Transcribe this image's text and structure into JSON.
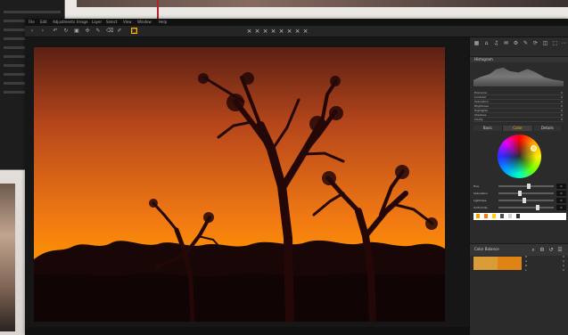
{
  "app": {
    "menu_items": [
      "File",
      "Edit",
      "Adjustments",
      "Image",
      "Layer",
      "Select",
      "View",
      "Window",
      "Help"
    ],
    "toolbar_icons": [
      "arrow-left-icon",
      "arrow-right-icon",
      "undo-icon",
      "rotate-icon",
      "crop-icon",
      "heal-icon",
      "brush-icon",
      "eraser-icon",
      "pen-icon",
      "box-icon"
    ],
    "toolbar_glyphs": [
      "‹",
      "›",
      "↶",
      "↻",
      "▣",
      "✣",
      "✎",
      "⌫",
      "✐",
      "▢"
    ],
    "viewer_control_glyphs": [
      "×",
      "×",
      "×",
      "×",
      "×",
      "×",
      "×",
      "×"
    ],
    "viewer_status_left": "",
    "viewer_status_center": "",
    "viewer_status_right": ""
  },
  "panel": {
    "top_glyphs": [
      "▦",
      "⌂",
      "♫",
      "✉",
      "⚙",
      "✎",
      "⟳",
      "◫",
      "⬚",
      "⋯"
    ],
    "histogram_title": "Histogram",
    "exposure_rows": [
      {
        "label": "Exposure",
        "value": "0"
      },
      {
        "label": "Contrast",
        "value": "0"
      },
      {
        "label": "Saturation",
        "value": "0"
      },
      {
        "label": "Brightness",
        "value": "0"
      },
      {
        "label": "Highlights",
        "value": "0"
      },
      {
        "label": "Shadows",
        "value": "0"
      },
      {
        "label": "Clarity",
        "value": "0"
      }
    ],
    "tabs": [
      "Basic",
      "Color",
      "Details"
    ],
    "sliders": [
      {
        "label": "Hue",
        "value": "0",
        "knob": 0.55
      },
      {
        "label": "Saturation",
        "value": "0",
        "knob": 0.38
      },
      {
        "label": "Lightness",
        "value": "0",
        "knob": 0.46
      },
      {
        "label": "Uniformity",
        "value": "0",
        "knob": 0.72
      }
    ],
    "color_title": "Color Balance",
    "mini_rows": [
      {
        "label": "R",
        "value": "0"
      },
      {
        "label": "G",
        "value": "0"
      },
      {
        "label": "B",
        "value": "0"
      },
      {
        "label": "L",
        "value": "0"
      }
    ],
    "swatch_colors": [
      "#f3a100",
      "#ff7b00",
      "#ffd200",
      "#4d4d4d",
      "#d0d0d0",
      "#2f2f2f"
    ],
    "before_color": "#d99c37",
    "after_color": "#df8315"
  }
}
